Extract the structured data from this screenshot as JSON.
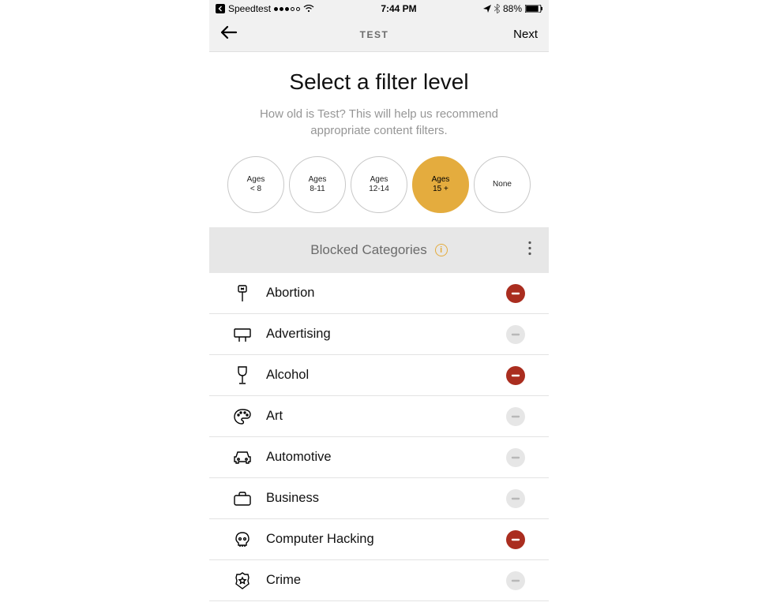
{
  "status_bar": {
    "breadcrumb_app": "Speedtest",
    "time": "7:44 PM",
    "battery_pct": "88%"
  },
  "nav": {
    "title": "TEST",
    "next": "Next"
  },
  "header": {
    "title": "Select a filter level",
    "subtitle": "How old is Test? This will help us recommend appropriate content filters."
  },
  "ages": [
    {
      "l1": "Ages",
      "l2": "< 8",
      "selected": false
    },
    {
      "l1": "Ages",
      "l2": "8-11",
      "selected": false
    },
    {
      "l1": "Ages",
      "l2": "12-14",
      "selected": false
    },
    {
      "l1": "Ages",
      "l2": "15 +",
      "selected": true
    },
    {
      "l1": "None",
      "l2": "",
      "selected": false
    }
  ],
  "section": {
    "title": "Blocked Categories"
  },
  "categories": [
    {
      "label": "Abortion",
      "icon": "protest-icon",
      "state": "blocked"
    },
    {
      "label": "Advertising",
      "icon": "billboard-icon",
      "state": "allowed"
    },
    {
      "label": "Alcohol",
      "icon": "wine-icon",
      "state": "blocked"
    },
    {
      "label": "Art",
      "icon": "palette-icon",
      "state": "allowed"
    },
    {
      "label": "Automotive",
      "icon": "car-icon",
      "state": "allowed"
    },
    {
      "label": "Business",
      "icon": "briefcase-icon",
      "state": "allowed"
    },
    {
      "label": "Computer Hacking",
      "icon": "skull-icon",
      "state": "blocked"
    },
    {
      "label": "Crime",
      "icon": "badge-icon",
      "state": "allowed"
    }
  ]
}
